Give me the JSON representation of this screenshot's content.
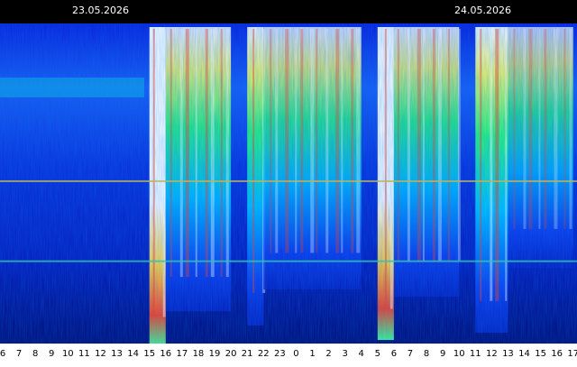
{
  "chart_data": {
    "type": "heatmap",
    "dates": [
      "23.05.2026",
      "24.05.2026"
    ],
    "x_ticks": [
      "6",
      "7",
      "8",
      "9",
      "10",
      "11",
      "12",
      "13",
      "14",
      "15",
      "16",
      "17",
      "18",
      "19",
      "20",
      "21",
      "22",
      "23",
      "0",
      "1",
      "2",
      "3",
      "4",
      "5",
      "6",
      "7",
      "8",
      "9",
      "10",
      "11",
      "12",
      "13",
      "14",
      "15",
      "16",
      "17"
    ],
    "colorscale": [
      "#000050",
      "#0000c8",
      "#0040ff",
      "#00c8ff",
      "#00ff80",
      "#ffff00",
      "#ff2000",
      "#ffffff"
    ],
    "activity_bands": [
      {
        "start": "15",
        "end": "16",
        "intensity": 1.0
      },
      {
        "start": "16",
        "end": "20",
        "intensity": 0.75
      },
      {
        "start": "21",
        "end": "22",
        "intensity": 0.85
      },
      {
        "start": "22",
        "end": "4",
        "intensity": 0.6
      },
      {
        "start": "5",
        "end": "6",
        "intensity": 0.95
      },
      {
        "start": "6",
        "end": "10",
        "intensity": 0.65
      },
      {
        "start": "11",
        "end": "13",
        "intensity": 0.9
      },
      {
        "start": "13",
        "end": "17",
        "intensity": 0.45
      }
    ],
    "horizontal_lines": [
      {
        "row": 0.49,
        "color": "#e0c040"
      },
      {
        "row": 0.74,
        "color": "#40d0a0"
      }
    ],
    "grid": false
  }
}
